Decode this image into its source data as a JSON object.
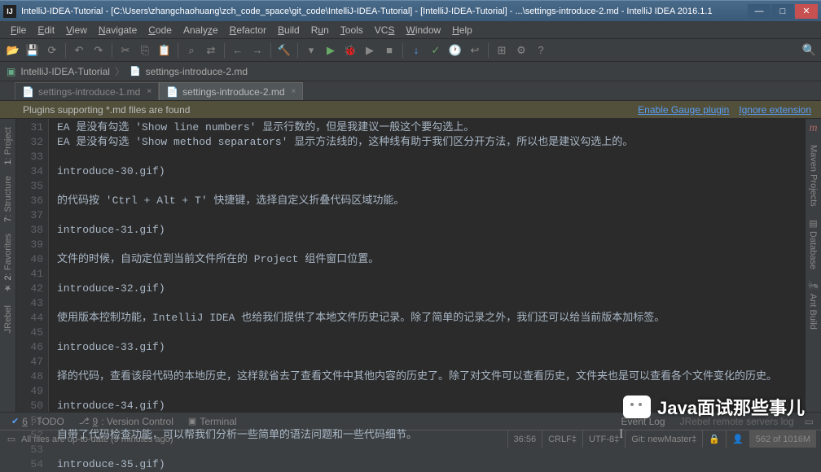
{
  "window": {
    "title": "IntelliJ-IDEA-Tutorial - [C:\\Users\\zhangchaohuang\\zch_code_space\\git_code\\IntelliJ-IDEA-Tutorial] - [IntelliJ-IDEA-Tutorial] - ...\\settings-introduce-2.md - IntelliJ IDEA 2016.1.1",
    "app_icon": "IJ"
  },
  "menu": [
    "File",
    "Edit",
    "View",
    "Navigate",
    "Code",
    "Analyze",
    "Refactor",
    "Build",
    "Run",
    "Tools",
    "VCS",
    "Window",
    "Help"
  ],
  "breadcrumb": {
    "project": "IntelliJ-IDEA-Tutorial",
    "file": "settings-introduce-2.md"
  },
  "tabs": [
    {
      "label": "settings-introduce-1.md",
      "active": false
    },
    {
      "label": "settings-introduce-2.md",
      "active": true
    }
  ],
  "notification": {
    "msg": "Plugins supporting *.md files are found",
    "link1": "Enable Gauge plugin",
    "link2": "Ignore extension"
  },
  "left_tools": [
    {
      "num": "1",
      "label": "Project"
    },
    {
      "num": "7",
      "label": "Structure"
    },
    {
      "num": "2",
      "label": "Favorites"
    },
    {
      "num": "",
      "label": "JRebel"
    }
  ],
  "right_tools": [
    {
      "label": "Maven Projects"
    },
    {
      "label": "Database"
    },
    {
      "label": "Ant Build"
    }
  ],
  "code_lines": [
    {
      "n": "31",
      "t": "EA 是没有勾选 'Show line numbers' 显示行数的，但是我建议一般这个要勾选上。"
    },
    {
      "n": "32",
      "t": "EA 是没有勾选 'Show method separators' 显示方法线的，这种线有助于我们区分开方法，所以也是建议勾选上的。"
    },
    {
      "n": "33",
      "t": ""
    },
    {
      "n": "34",
      "t": "introduce-30.gif)"
    },
    {
      "n": "35",
      "t": ""
    },
    {
      "n": "36",
      "t": "的代码按 'Ctrl + Alt + T' 快捷键，选择自定义折叠代码区域功能。"
    },
    {
      "n": "37",
      "t": ""
    },
    {
      "n": "38",
      "t": "introduce-31.gif)"
    },
    {
      "n": "39",
      "t": ""
    },
    {
      "n": "40",
      "t": "文件的时候，自动定位到当前文件所在的 Project 组件窗口位置。"
    },
    {
      "n": "41",
      "t": ""
    },
    {
      "n": "42",
      "t": "introduce-32.gif)"
    },
    {
      "n": "43",
      "t": ""
    },
    {
      "n": "44",
      "t": "使用版本控制功能，IntelliJ IDEA 也给我们提供了本地文件历史记录。除了简单的记录之外，我们还可以给当前版本加标签。"
    },
    {
      "n": "45",
      "t": ""
    },
    {
      "n": "46",
      "t": "introduce-33.gif)"
    },
    {
      "n": "47",
      "t": ""
    },
    {
      "n": "48",
      "t": "择的代码，查看该段代码的本地历史，这样就省去了查看文件中其他内容的历史了。除了对文件可以查看历史，文件夹也是可以查看各个文件变化的历史。"
    },
    {
      "n": "49",
      "t": ""
    },
    {
      "n": "50",
      "t": "introduce-34.gif)"
    },
    {
      "n": "51",
      "t": ""
    },
    {
      "n": "52",
      "t": "自带了代码检查功能，可以帮我们分析一些简单的语法问题和一些代码细节。"
    },
    {
      "n": "53",
      "t": ""
    },
    {
      "n": "54",
      "t": "introduce-35.gif)"
    }
  ],
  "bottom_tabs": [
    {
      "num": "6",
      "label": "TODO"
    },
    {
      "num": "9",
      "label": "Version Control"
    },
    {
      "num": "",
      "label": "Terminal"
    }
  ],
  "bottom_right": {
    "event_log": "Event Log",
    "jrebel": "JRebel remote servers log"
  },
  "status": {
    "msg": "All files are up-to-date (9 minutes ago)",
    "pos": "36:56",
    "sep": "CRLF‡",
    "enc": "UTF-8‡",
    "git": "Git: newMaster‡",
    "mem": "562 of 1016M"
  },
  "watermark": "Java面试那些事儿"
}
